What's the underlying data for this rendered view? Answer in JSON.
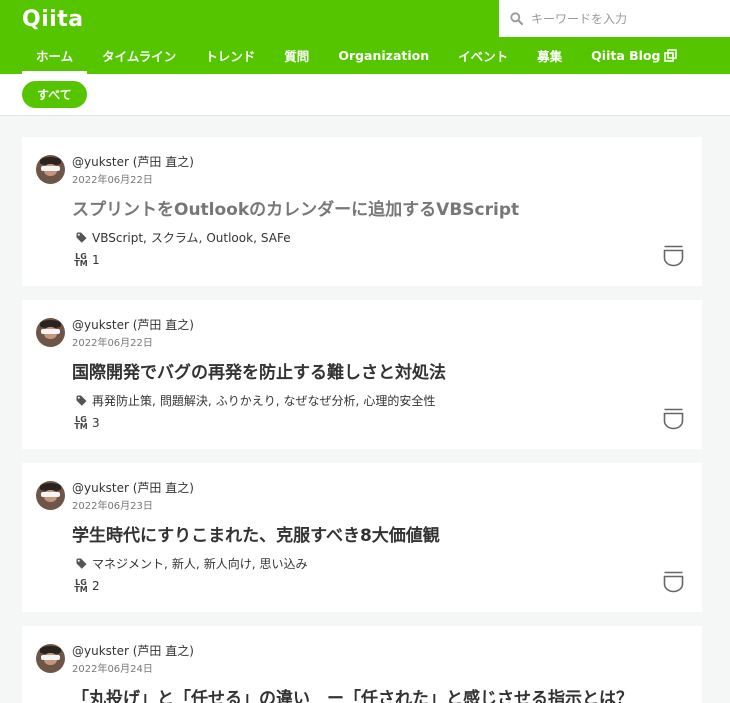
{
  "header": {
    "logo": "Qiita",
    "search": {
      "placeholder": "キーワードを入力"
    }
  },
  "nav": {
    "items": [
      {
        "label": "ホーム",
        "active": true
      },
      {
        "label": "タイムライン"
      },
      {
        "label": "トレンド"
      },
      {
        "label": "質問"
      },
      {
        "label": "Organization"
      },
      {
        "label": "イベント"
      },
      {
        "label": "募集"
      },
      {
        "label": "Qiita Blog",
        "external": true
      }
    ]
  },
  "filter": {
    "label": "すべて"
  },
  "articles": [
    {
      "author": "@yukster (芦田 直之)",
      "date": "2022年06月22日",
      "title": "スプリントをOutlookのカレンダーに追加するVBScript",
      "visited": true,
      "tags": [
        "VBScript",
        "スクラム",
        "Outlook",
        "SAFe"
      ],
      "lgtm": "1"
    },
    {
      "author": "@yukster (芦田 直之)",
      "date": "2022年06月22日",
      "title": "国際開発でバグの再発を防止する難しさと対処法",
      "tags": [
        "再発防止策",
        "問題解決",
        "ふりかえり",
        "なぜなぜ分析",
        "心理的安全性"
      ],
      "lgtm": "3"
    },
    {
      "author": "@yukster (芦田 直之)",
      "date": "2022年06月23日",
      "title": "学生時代にすりこまれた、克服すべき8大価値観",
      "tags": [
        "マネジメント",
        "新人",
        "新人向け",
        "思い込み"
      ],
      "lgtm": "2"
    },
    {
      "author": "@yukster (芦田 直之)",
      "date": "2022年06月24日",
      "title": "「丸投げ」と「任せる」の違い　ー「任された」と感じさせる指示とは？"
    }
  ],
  "colors": {
    "brand": "#55c500",
    "background": "#f5f6f6"
  },
  "icons": {
    "search": "search-icon",
    "tag": "tag-icon",
    "stock": "stock-icon",
    "external": "external-link-icon",
    "lgtm": "lgtm-icon"
  }
}
